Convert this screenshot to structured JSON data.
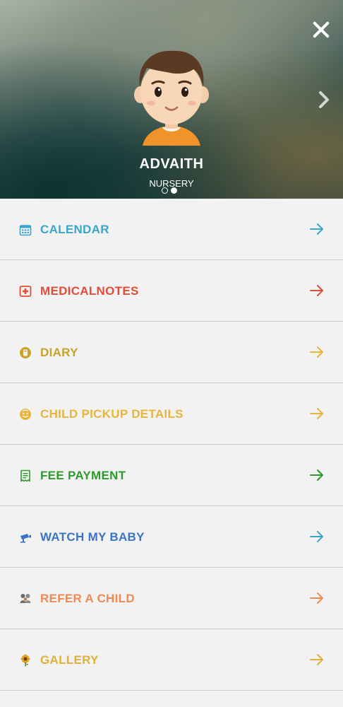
{
  "header": {
    "child_name": "ADVAITH",
    "child_class": "NURSERY",
    "close_icon": "close-icon",
    "next_icon": "chevron-right-icon",
    "carousel_active_index": 1,
    "carousel_count": 2
  },
  "menu": {
    "items": [
      {
        "label": "CALENDAR",
        "icon": "calendar-icon",
        "color": "#3aa6c9"
      },
      {
        "label": "MEDICALNOTES",
        "icon": "medical-cross-icon",
        "color": "#e04d3a"
      },
      {
        "label": "DIARY",
        "icon": "diary-icon",
        "color": "#c9a227"
      },
      {
        "label": "CHILD PICKUP DETAILS",
        "icon": "child-face-icon",
        "color": "#e8b53c"
      },
      {
        "label": "FEE PAYMENT",
        "icon": "receipt-icon",
        "color": "#2e9a2e"
      },
      {
        "label": "WATCH MY BABY",
        "icon": "camera-icon",
        "color": "#3a73c9"
      },
      {
        "label": "REFER A CHILD",
        "icon": "children-icon",
        "color": "#ef8a55"
      },
      {
        "label": "GALLERY",
        "icon": "sunflower-icon",
        "color": "#e0b13a"
      }
    ]
  }
}
